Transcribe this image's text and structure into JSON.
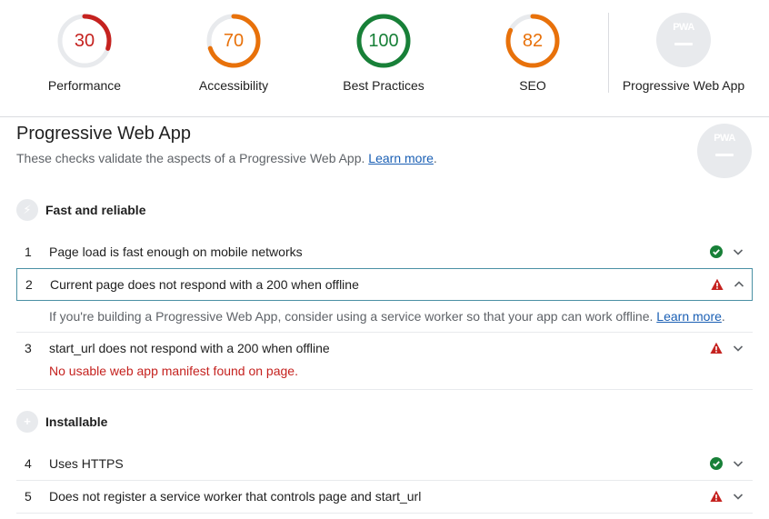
{
  "scores": [
    {
      "label": "Performance",
      "value": "30",
      "fraction": 0.3,
      "color": "#c5221f"
    },
    {
      "label": "Accessibility",
      "value": "70",
      "fraction": 0.7,
      "color": "#e8710a"
    },
    {
      "label": "Best Practices",
      "value": "100",
      "fraction": 1.0,
      "color": "#188038"
    },
    {
      "label": "SEO",
      "value": "82",
      "fraction": 0.82,
      "color": "#e8710a"
    }
  ],
  "pwa_summary": {
    "label": "Progressive Web App",
    "badge_text": "PWA"
  },
  "category": {
    "title": "Progressive Web App",
    "description": "These checks validate the aspects of a Progressive Web App.",
    "learn_more": "Learn more",
    "period": "."
  },
  "groups": [
    {
      "title": "Fast and reliable",
      "icon": "lightning-icon"
    },
    {
      "title": "Installable",
      "icon": "plus-icon"
    }
  ],
  "audits": [
    {
      "index": "1",
      "title": "Page load is fast enough on mobile networks",
      "status": "pass"
    },
    {
      "index": "2",
      "title": "Current page does not respond with a 200 when offline",
      "status": "fail",
      "detail": "If you're building a Progressive Web App, consider using a service worker so that your app can work offline.",
      "detail_link": "Learn more",
      "detail_period": "."
    },
    {
      "index": "3",
      "title": "start_url does not respond with a 200 when offline",
      "status": "fail",
      "error": "No usable web app manifest found on page."
    },
    {
      "index": "4",
      "title": "Uses HTTPS",
      "status": "pass"
    },
    {
      "index": "5",
      "title": "Does not register a service worker that controls page and start_url",
      "status": "fail"
    }
  ],
  "colors": {
    "pass": "#188038",
    "fail": "#c5221f",
    "link": "#1a5fb4",
    "badge": "#e8eaed"
  }
}
